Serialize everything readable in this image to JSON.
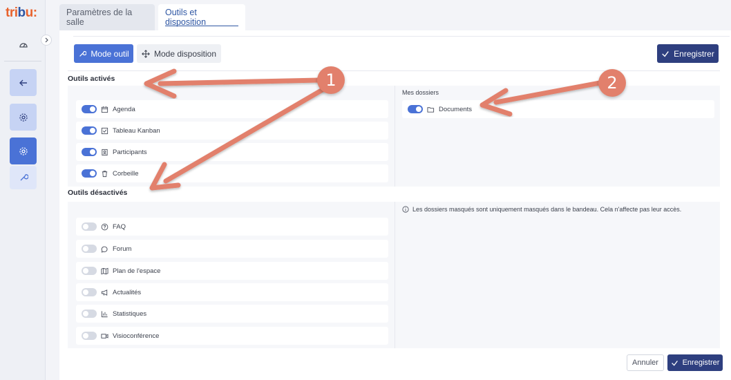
{
  "sidebar": {
    "logo": {
      "t": "tri",
      "b": "b",
      "u": "u",
      "suffix": ":"
    },
    "items": [
      {
        "icon": "dashboard-icon"
      },
      {
        "icon": "back-arrow-icon"
      },
      {
        "icon": "gear-icon"
      },
      {
        "icon": "gear-icon"
      },
      {
        "icon": "wrench-icon"
      }
    ]
  },
  "tabs": [
    {
      "label": "Paramètres de la salle",
      "active": false
    },
    {
      "label": "Outils et disposition",
      "active": true
    }
  ],
  "toolbar": {
    "mode_outil": "Mode outil",
    "mode_disposition": "Mode disposition",
    "save": "Enregistrer"
  },
  "sections": {
    "active_title": "Outils activés",
    "inactive_title": "Outils désactivés"
  },
  "active_tools": [
    {
      "label": "Agenda",
      "icon": "calendar-icon",
      "enabled": true
    },
    {
      "label": "Tableau Kanban",
      "icon": "checkbox-icon",
      "enabled": true
    },
    {
      "label": "Participants",
      "icon": "contact-icon",
      "enabled": true
    },
    {
      "label": "Corbeille",
      "icon": "trash-icon",
      "enabled": true
    }
  ],
  "folders": {
    "title": "Mes dossiers",
    "items": [
      {
        "label": "Documents",
        "icon": "folder-icon",
        "enabled": true
      }
    ],
    "info": "Les dossiers masqués sont uniquement masqués dans le bandeau. Cela n'affecte pas leur accès."
  },
  "inactive_tools": [
    {
      "label": "FAQ",
      "icon": "question-icon",
      "enabled": false
    },
    {
      "label": "Forum",
      "icon": "chat-icon",
      "enabled": false
    },
    {
      "label": "Plan de l'espace",
      "icon": "map-icon",
      "enabled": false
    },
    {
      "label": "Actualités",
      "icon": "megaphone-icon",
      "enabled": false
    },
    {
      "label": "Statistiques",
      "icon": "bar-chart-icon",
      "enabled": false
    },
    {
      "label": "Visioconférence",
      "icon": "video-icon",
      "enabled": false
    }
  ],
  "footer": {
    "cancel": "Annuler",
    "save": "Enregistrer"
  },
  "annotations": {
    "badge1": "1",
    "badge2": "2",
    "color": "#e2806c"
  },
  "colors": {
    "primary": "#4a72d6",
    "dark_primary": "#2e3f7f",
    "logo_orange": "#e8632e",
    "logo_blue": "#2e56a3"
  }
}
